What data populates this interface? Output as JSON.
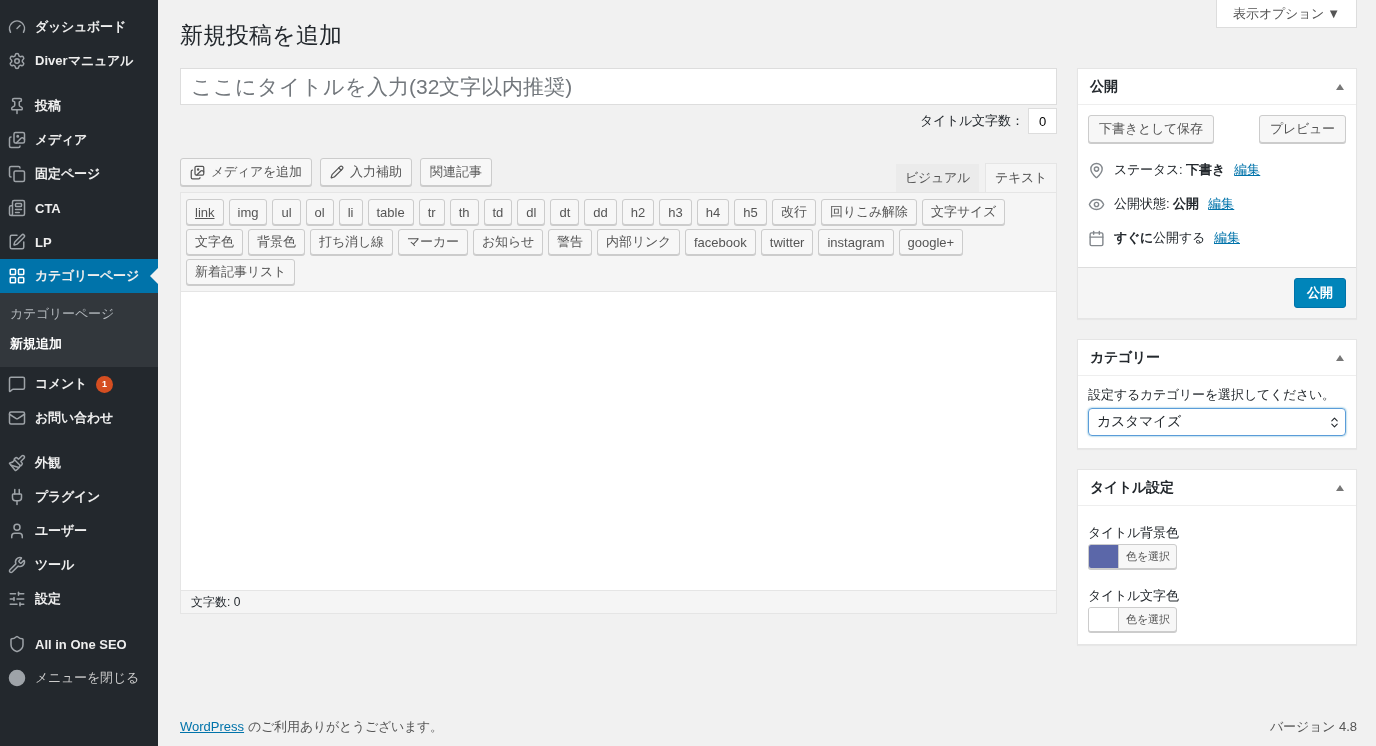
{
  "sidebar": {
    "groups": [
      [
        {
          "label": "ダッシュボード",
          "selected": false
        },
        {
          "label": "Diverマニュアル",
          "selected": false
        }
      ],
      [
        {
          "label": "投稿",
          "selected": false
        },
        {
          "label": "メディア",
          "selected": false
        },
        {
          "label": "固定ページ",
          "selected": false
        },
        {
          "label": "CTA",
          "selected": false
        },
        {
          "label": "LP",
          "selected": false
        },
        {
          "label": "カテゴリーページ",
          "selected": true,
          "children": [
            {
              "label": "カテゴリーページ",
              "selected": false
            },
            {
              "label": "新規追加",
              "selected": true
            }
          ]
        },
        {
          "label": "コメント",
          "selected": false,
          "badge": "1"
        },
        {
          "label": "お問い合わせ",
          "selected": false
        }
      ],
      [
        {
          "label": "外観",
          "selected": false
        },
        {
          "label": "プラグイン",
          "selected": false
        },
        {
          "label": "ユーザー",
          "selected": false
        },
        {
          "label": "ツール",
          "selected": false
        },
        {
          "label": "設定",
          "selected": false
        }
      ],
      [
        {
          "label": "All in One SEO",
          "selected": false
        },
        {
          "label": "メニューを閉じる",
          "selected": false,
          "kind": "collapse"
        }
      ]
    ]
  },
  "screen_options": "表示オプション ▼",
  "page_title": "新規投稿を追加",
  "title_field": {
    "placeholder": "ここにタイトルを入力(32文字以内推奨)"
  },
  "title_count": {
    "label": "タイトル文字数：",
    "value": "0"
  },
  "media_buttons": [
    "メディアを追加",
    "入力補助",
    "関連記事"
  ],
  "editor_tabs": [
    {
      "label": "ビジュアル",
      "selected": false
    },
    {
      "label": "テキスト",
      "selected": true
    }
  ],
  "quicktags": [
    {
      "label": "link",
      "kind": "link"
    },
    {
      "label": "img",
      "kind": "tag"
    },
    {
      "label": "ul",
      "kind": "tag"
    },
    {
      "label": "ol",
      "kind": "tag"
    },
    {
      "label": "li",
      "kind": "tag"
    },
    {
      "label": "table",
      "kind": "tag"
    },
    {
      "label": "tr",
      "kind": "tag"
    },
    {
      "label": "th",
      "kind": "tag"
    },
    {
      "label": "td",
      "kind": "tag"
    },
    {
      "label": "dl",
      "kind": "tag"
    },
    {
      "label": "dt",
      "kind": "tag"
    },
    {
      "label": "dd",
      "kind": "tag"
    },
    {
      "label": "h2",
      "kind": "tag"
    },
    {
      "label": "h3",
      "kind": "tag"
    },
    {
      "label": "h4",
      "kind": "tag"
    },
    {
      "label": "h5",
      "kind": "tag"
    },
    {
      "label": "改行",
      "kind": "tag"
    },
    {
      "label": "回りこみ解除",
      "kind": "tag"
    },
    {
      "label": "文字サイズ",
      "kind": "tag"
    },
    {
      "label": "文字色",
      "kind": "tag"
    },
    {
      "label": "背景色",
      "kind": "tag"
    },
    {
      "label": "打ち消し線",
      "kind": "tag"
    },
    {
      "label": "マーカー",
      "kind": "tag"
    },
    {
      "label": "お知らせ",
      "kind": "tag"
    },
    {
      "label": "警告",
      "kind": "tag"
    },
    {
      "label": "内部リンク",
      "kind": "tag"
    },
    {
      "label": "facebook",
      "kind": "tag"
    },
    {
      "label": "twitter",
      "kind": "tag"
    },
    {
      "label": "instagram",
      "kind": "tag"
    },
    {
      "label": "google+",
      "kind": "tag"
    },
    {
      "label": "新着記事リスト",
      "kind": "tag"
    }
  ],
  "word_count": "文字数: 0",
  "publish_box": {
    "title": "公開",
    "save_draft": "下書きとして保存",
    "preview": "プレビュー",
    "rows": [
      {
        "text": "ステータス: **下書き**",
        "link": "編集"
      },
      {
        "text": "公開状態: **公開**",
        "link": "編集"
      },
      {
        "text": "**すぐに**公開する",
        "link": "編集"
      }
    ],
    "publish": "公開"
  },
  "category_box": {
    "title": "カテゴリー",
    "label": "設定するカテゴリーを選択してください。",
    "value": "カスタマイズ"
  },
  "title_settings_box": {
    "title": "タイトル設定",
    "pickers": [
      {
        "label": "タイトル背景色",
        "color": "#5b67a9",
        "button": "色を選択"
      },
      {
        "label": "タイトル文字色",
        "color": "#ffffff",
        "button": "色を選択"
      }
    ]
  },
  "footer": {
    "thanks_link": "WordPress",
    "thanks_text": " のご利用ありがとうございます。",
    "version": "バージョン 4.8"
  }
}
